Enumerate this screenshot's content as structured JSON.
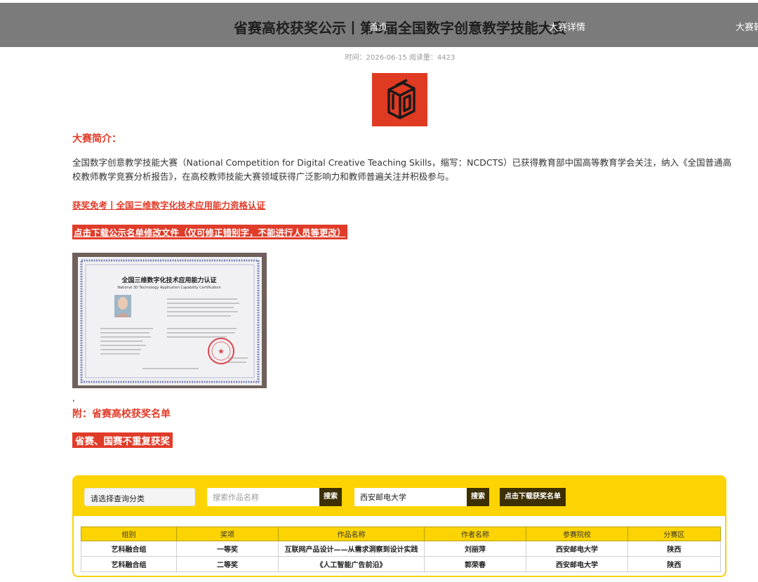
{
  "header": {
    "title": "省赛高校获奖公示丨第5届全国数字创意教学技能大赛",
    "nav": [
      "首页",
      "大赛详情",
      "大赛韩"
    ]
  },
  "meta": {
    "text": "时间：2026-06-15 阅读量：4423"
  },
  "intro": {
    "heading": "大赛简介：",
    "body": "全国数字创意教学技能大赛（National Competition for Digital Creative Teaching Skills，缩写：NCDCTS）已获得教育部中国高等教育学会关注，纳入《全国普通高校教师教学竞赛分析报告》，在高校教师技能大赛领域获得广泛影响力和教师普遍关注并积极参与。"
  },
  "links": {
    "exam_link": "获奖免考丨全国三维数字化技术应用能力资格认证",
    "download_fix": "点击下载公示名单修改文件（仅可修正错别字，不能进行人员等更改）"
  },
  "certificate": {
    "title_cn": "全国三维数字化技术应用能力认证",
    "title_en": "National 3D Technology Application Capability Certification"
  },
  "comma": ",",
  "appendix": {
    "heading": "附：省赛高校获奖名单",
    "notice": "省赛、国赛不重复获奖"
  },
  "search": {
    "category_placeholder": "请选择查询分类",
    "work_placeholder": "搜索作品名称",
    "work_value": "",
    "search_btn1": "搜索",
    "school_value": "西安邮电大学",
    "search_btn2": "搜索",
    "download_btn": "点击下载获奖名单"
  },
  "table": {
    "headers": [
      "组别",
      "奖项",
      "作品名称",
      "作者名称",
      "参赛院校",
      "分赛区"
    ],
    "rows": [
      [
        "艺科融合组",
        "一等奖",
        "互联网产品设计——从需求洞察到设计实践",
        "刘丽萍",
        "西安邮电大学",
        "陕西"
      ],
      [
        "艺科融合组",
        "二等奖",
        "《人工智能广告前沿》",
        "郭荣春",
        "西安邮电大学",
        "陕西"
      ]
    ]
  },
  "colors": {
    "accent_red": "#e03c2a",
    "panel_yellow": "#fcd403",
    "button_dark": "#3d2f05",
    "header_gray": "#7b7b7b"
  }
}
